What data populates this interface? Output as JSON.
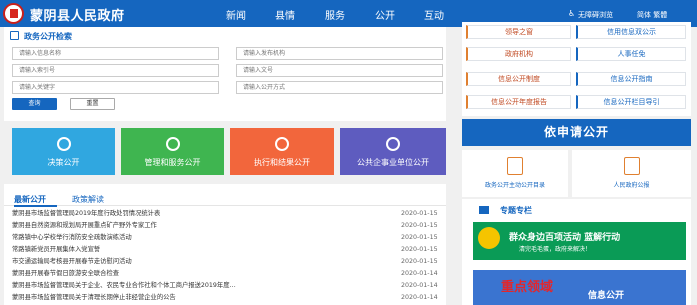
{
  "header": {
    "site_title": "蒙阴县人民政府",
    "nav": [
      "新闻",
      "县情",
      "服务",
      "公开",
      "互动"
    ],
    "accessibility_label": "无障碍浏览",
    "lang_label": "简体 繁體"
  },
  "search_panel": {
    "title": "政务公开检索",
    "placeholders": [
      "请输入信息名称",
      "请输入发布机构",
      "请输入索引号",
      "请输入文号",
      "请输入关键字",
      "请输入公开方式"
    ],
    "query_button": "查询",
    "reset_button": "重置"
  },
  "tiles": [
    {
      "label": "决策公开",
      "color": "#30a7e0"
    },
    {
      "label": "管理和服务公开",
      "color": "#3fb550"
    },
    {
      "label": "执行和结果公开",
      "color": "#f2663c"
    },
    {
      "label": "公共企事业单位公开",
      "color": "#5e5cbf"
    }
  ],
  "news": {
    "tab_active": "最新公开",
    "tab_other": "政策解读",
    "items": [
      {
        "title": "蒙阴县市场监督管理局2019年度行政处罚情况统计表",
        "date": "2020-01-15"
      },
      {
        "title": "蒙阴县自然资源和规划局开展重点矿产野外专家工作",
        "date": "2020-01-15"
      },
      {
        "title": "常路镇中心学校举行消防安全疏散演练活动",
        "date": "2020-01-15"
      },
      {
        "title": "常路镇新党员开展集体入党宣誓",
        "date": "2020-01-15"
      },
      {
        "title": "市交通运输局考核县开展春节走访慰问活动",
        "date": "2020-01-15"
      },
      {
        "title": "蒙阴县开展春节假日旅游安全联合检查",
        "date": "2020-01-14"
      },
      {
        "title": "蒙阴县市场监督管理局关于企业、农民专业合作社和个体工商户报送2019年度…",
        "date": "2020-01-14"
      },
      {
        "title": "蒙阴县市场监督管理局关于清理长期停止非经营企业的公告",
        "date": "2020-01-14"
      }
    ]
  },
  "right_links": {
    "row0": [
      "领导之窗",
      "信用信息双公示"
    ],
    "row1": [
      "政府机构",
      "人事任免"
    ],
    "row2": [
      "信息公开制度",
      "信息公开指南"
    ],
    "row3": [
      "信息公开年度报告",
      "信息公开栏目导引"
    ]
  },
  "apply": {
    "banner": "依申请公开",
    "left_label": "政务公开主动公开目录",
    "right_label": "人民政府公报"
  },
  "topics": {
    "title": "专题专栏",
    "banner1_main": "群众身边百项活动 蓝解行动",
    "banner1_sub": "清完毛毛蛋，政府来解决！",
    "banner2_main": "重点领域",
    "banner2_sub": "信息公开"
  }
}
